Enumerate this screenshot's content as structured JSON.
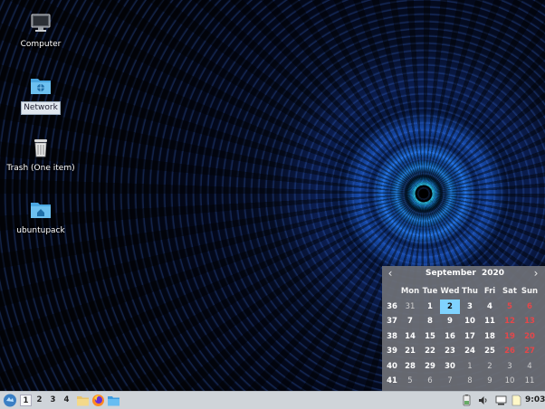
{
  "desktop": {
    "icons": [
      {
        "label": "Computer",
        "icon": "computer-icon"
      },
      {
        "label": "Network",
        "icon": "network-folder-icon"
      },
      {
        "label": "Trash (One item)",
        "icon": "trash-icon"
      },
      {
        "label": "ubuntupack",
        "icon": "home-folder-icon"
      }
    ]
  },
  "calendar": {
    "month": "September",
    "year": "2020",
    "prev": "‹",
    "next": "›",
    "weekdays": [
      "Mon",
      "Tue",
      "Wed",
      "Thu",
      "Fri",
      "Sat",
      "Sun"
    ],
    "rows": [
      {
        "week": "36",
        "days": [
          "31",
          "1",
          "2",
          "3",
          "4",
          "5",
          "6"
        ]
      },
      {
        "week": "37",
        "days": [
          "7",
          "8",
          "9",
          "10",
          "11",
          "12",
          "13"
        ]
      },
      {
        "week": "38",
        "days": [
          "14",
          "15",
          "16",
          "17",
          "18",
          "19",
          "20"
        ]
      },
      {
        "week": "39",
        "days": [
          "21",
          "22",
          "23",
          "24",
          "25",
          "26",
          "27"
        ]
      },
      {
        "week": "40",
        "days": [
          "28",
          "29",
          "30",
          "1",
          "2",
          "3",
          "4"
        ]
      },
      {
        "week": "41",
        "days": [
          "5",
          "6",
          "7",
          "8",
          "9",
          "10",
          "11"
        ]
      }
    ],
    "today": "2",
    "colors": {
      "weekend": "#e4474a",
      "today": "#7fd3ff"
    }
  },
  "panel": {
    "workspaces": [
      "1",
      "2",
      "3",
      "4"
    ],
    "active_workspace": "1",
    "launchers": [
      "file-manager-icon",
      "firefox-icon",
      "folder-icon"
    ],
    "tray": [
      "battery-icon",
      "volume-icon",
      "network-monitor-icon",
      "notes-icon"
    ],
    "clock": "9:03"
  }
}
